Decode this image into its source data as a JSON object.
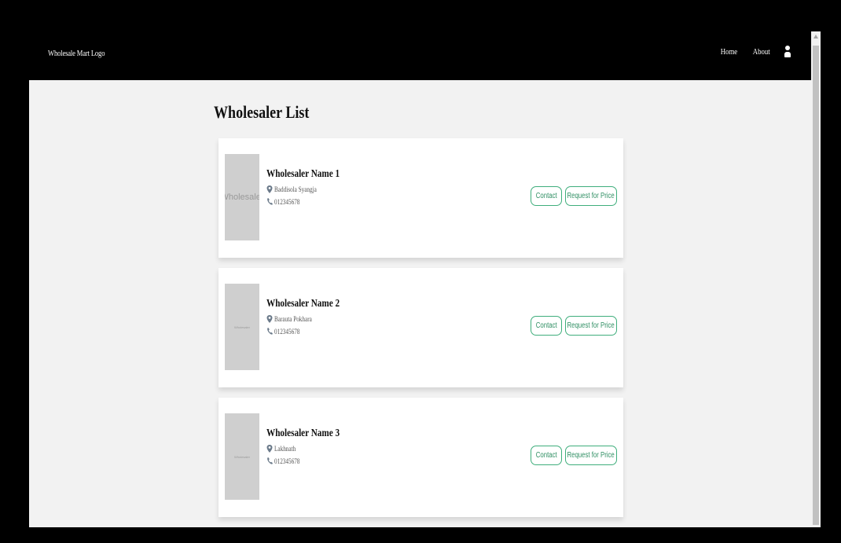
{
  "navbar": {
    "logo": "Wholesale Mart Logo",
    "links": [
      "Home",
      "About"
    ]
  },
  "page": {
    "title": "Wholesaler List"
  },
  "wholesalers": [
    {
      "thumb": "Wholesaler",
      "name": "Wholesaler Name 1",
      "location": "Baddisola Syangja",
      "phone": "012345678",
      "contact": "Contact",
      "request": "Request for Price"
    },
    {
      "thumb": "Wholesaler",
      "name": "Wholesaler Name 2",
      "location": "Barauta Pokhara",
      "phone": "012345678",
      "contact": "Contact",
      "request": "Request for Price"
    },
    {
      "thumb": "Wholesaler",
      "name": "Wholesaler Name 3",
      "location": "Lakhnath",
      "phone": "012345678",
      "contact": "Contact",
      "request": "Request for Price"
    }
  ],
  "colors": {
    "accent": "#3fae7c",
    "navbar": "#000000",
    "background": "#f2f2f2"
  }
}
